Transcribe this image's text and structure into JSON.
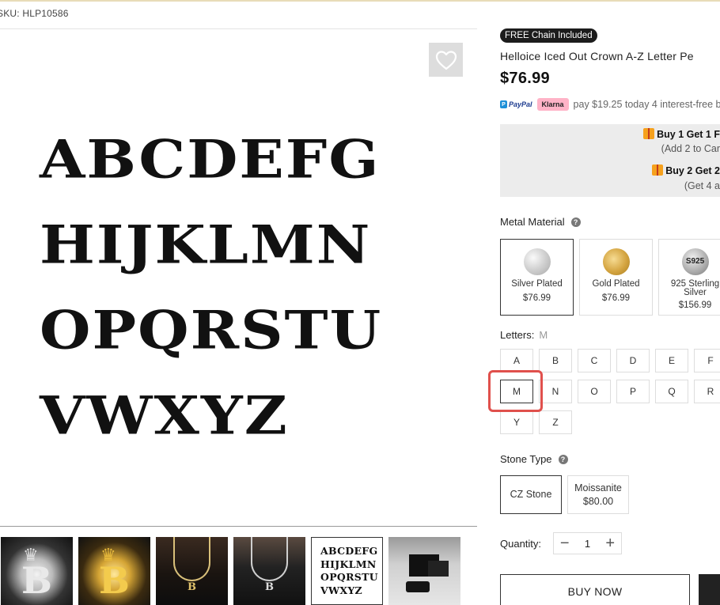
{
  "product": {
    "sku_label": "SKU: HLP10586",
    "badge": "FREE Chain Included",
    "title": "Helloice Iced Out Crown A-Z Letter Pe",
    "price": "$76.99"
  },
  "main_image": {
    "lines": [
      "ABCDEFG",
      "HIJKLMN",
      "OPQRSTU",
      "VWXYZ"
    ]
  },
  "thumbnails": [
    {
      "kind": "silver-crown-B",
      "letter": "B"
    },
    {
      "kind": "gold-crown-B",
      "letter": "B"
    },
    {
      "kind": "model-gold-chain",
      "letter": "B"
    },
    {
      "kind": "model-silver-chain",
      "letter": "B"
    },
    {
      "kind": "alphabet-chart",
      "lines": [
        "ABCDEFG",
        "HIJKLMN",
        "OPQRSTU",
        "VWXYZ"
      ],
      "selected": true
    },
    {
      "kind": "packaging-boxes"
    }
  ],
  "payment": {
    "paypal": "PayPal",
    "klarna": "Klarna",
    "text": "pay $19.25 today 4 interest-free bi"
  },
  "promo": {
    "line1": "Buy 1 Get 1 F",
    "line1_sub": "(Add 2 to Car",
    "line2": "Buy 2 Get 2",
    "line2_sub": "(Get 4 a"
  },
  "metal": {
    "label": "Metal Material",
    "help_icon": "question-mark-icon",
    "options": [
      {
        "name": "Silver Plated",
        "price": "$76.99",
        "swatch": "silver",
        "selected": true
      },
      {
        "name": "Gold Plated",
        "price": "$76.99",
        "swatch": "gold"
      },
      {
        "name": "925 Sterling Silver",
        "name_line1": "925 Sterling",
        "name_line2": "Silver",
        "price": "$156.99",
        "swatch_text": "S925"
      }
    ]
  },
  "letters": {
    "label": "Letters:",
    "current": "M",
    "options": [
      "A",
      "B",
      "C",
      "D",
      "E",
      "F",
      "M",
      "N",
      "O",
      "P",
      "Q",
      "R",
      "Y",
      "Z"
    ],
    "selected": "M"
  },
  "stone": {
    "label": "Stone Type",
    "options": [
      {
        "name": "CZ Stone",
        "price": "",
        "selected": true
      },
      {
        "name": "Moissanite",
        "price": "$80.00"
      }
    ]
  },
  "quantity": {
    "label": "Quantity:",
    "value": "1",
    "minus": "−",
    "plus": "+"
  },
  "actions": {
    "buy_now": "BUY NOW"
  },
  "colors": {
    "badge_bg": "#1c1c1c",
    "klarna_pink": "#ffb3c7",
    "highlight_red": "#e0504c",
    "promo_bg": "#ececec"
  }
}
